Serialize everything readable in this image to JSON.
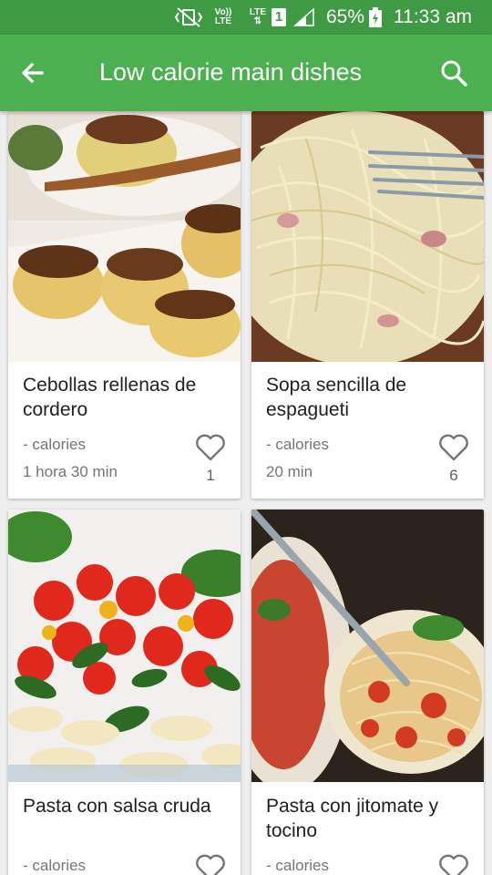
{
  "status_bar": {
    "volte_top": "Vo))",
    "volte_bottom": "LTE",
    "network_top": "LTE",
    "sim": "1",
    "battery_percent": "65%",
    "time": "11:33 am"
  },
  "app_bar": {
    "title": "Low calorie main dishes",
    "back_icon": "arrow-back-icon",
    "search_icon": "search-icon"
  },
  "recipes": [
    {
      "name": "Cebollas rellenas de cordero",
      "calories": "- calories",
      "time": "1 hora 30 min",
      "likes": "1"
    },
    {
      "name": "Sopa sencilla de espagueti",
      "calories": "- calories",
      "time": "20 min",
      "likes": "6"
    },
    {
      "name": "Pasta con salsa cruda",
      "calories": "- calories",
      "time": "",
      "likes": ""
    },
    {
      "name": "Pasta con jitomate y tocino",
      "calories": "- calories",
      "time": "",
      "likes": ""
    }
  ],
  "colors": {
    "status_bar": "#3e9b43",
    "app_bar": "#4caf50",
    "background": "#eeeeee"
  }
}
